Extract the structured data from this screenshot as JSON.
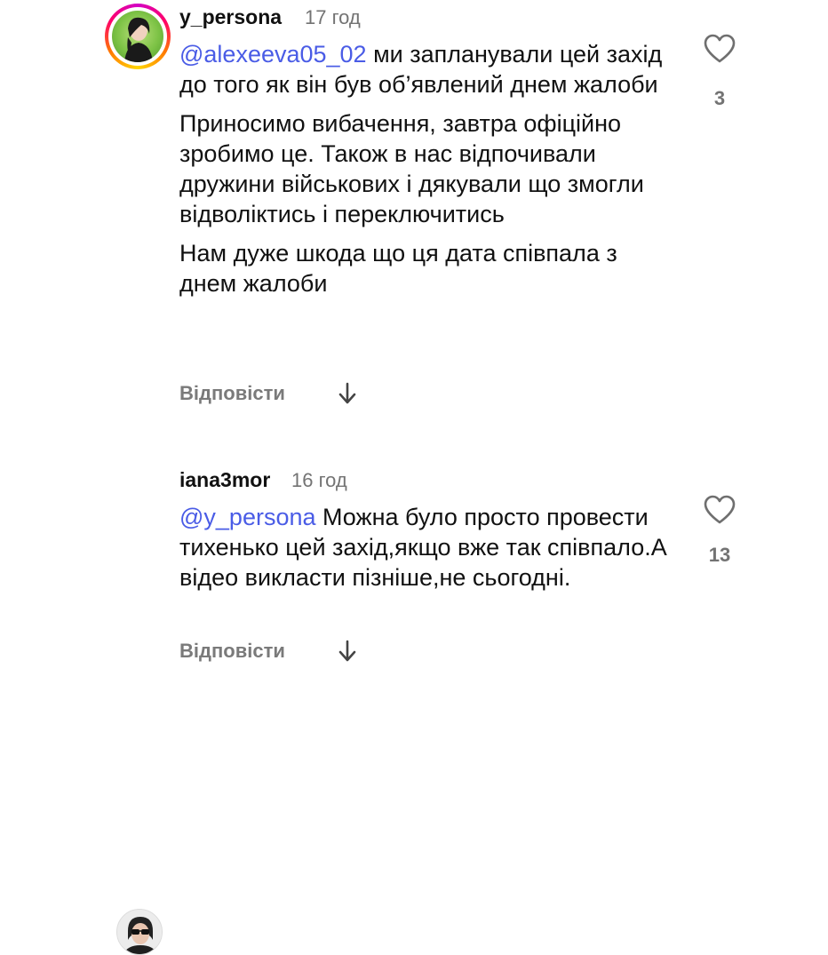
{
  "comments": [
    {
      "username": "y_persona",
      "time": "17 год",
      "mention": "@alexeeva05_02",
      "paragraphs": [
        "ми запланували цей захід до того як він був об’явлений днем жалоби",
        "Приносимо вибачення, завтра офіційно зробимо це. Також в нас відпочивали дружини військових і дякували що змогли відволіктись і переключитись",
        "Нам дуже шкода що ця дата співпала з днем жалоби"
      ],
      "reply_label": "Відповісти",
      "likes": "3",
      "avatar_icon": "profile-photo-woman-green-background"
    },
    {
      "username": "iana3mor",
      "time": "16 год",
      "mention": "@y_persona",
      "paragraphs": [
        "Можна було просто провести тихенько цей захід,якщо вже так співпало.А  відео викласти пізніше,не сьогодні."
      ],
      "reply_label": "Відповісти",
      "likes": "13",
      "avatar_icon": "profile-photo-woman-sunglasses"
    }
  ],
  "icons": {
    "like": "heart-outline-icon",
    "expand_replies": "arrow-down-icon"
  },
  "colors": {
    "mention": "#4a5ce6",
    "secondary_text": "#737373",
    "primary_text": "#111111"
  }
}
